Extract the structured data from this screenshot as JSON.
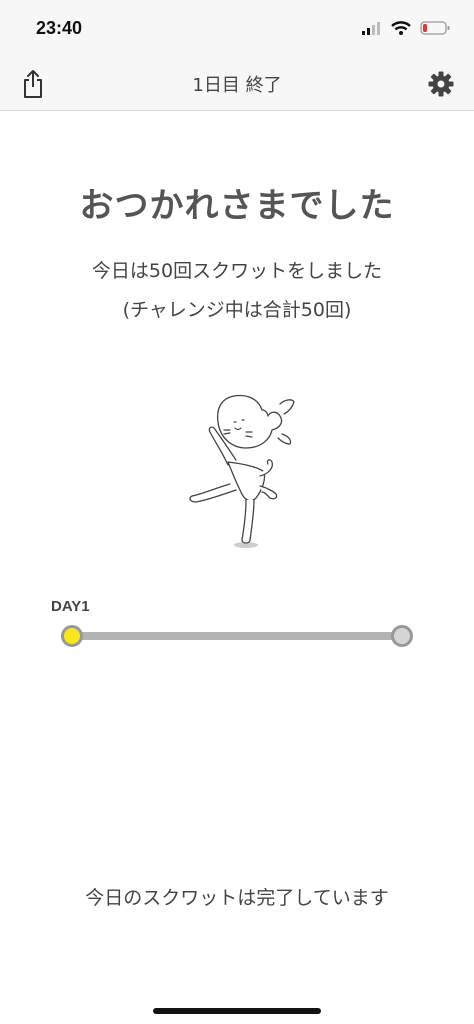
{
  "status_bar": {
    "time": "23:40",
    "battery_color": "#e53935"
  },
  "nav": {
    "title": "1日目 終了",
    "share_icon": "share-icon",
    "settings_icon": "gear-icon"
  },
  "main": {
    "headline": "おつかれさまでした",
    "summary_line1": "今日は50回スクワットをしました",
    "summary_line2": "(チャレンジ中は合計50回)",
    "illustration": "cat-dancing-illustration"
  },
  "progress": {
    "label": "DAY1",
    "current_day": 1,
    "start_color": "#f8e71c",
    "end_color": "#d6d6d6",
    "track_color": "#b3b3b3"
  },
  "footer": {
    "message": "今日のスクワットは完了しています"
  }
}
